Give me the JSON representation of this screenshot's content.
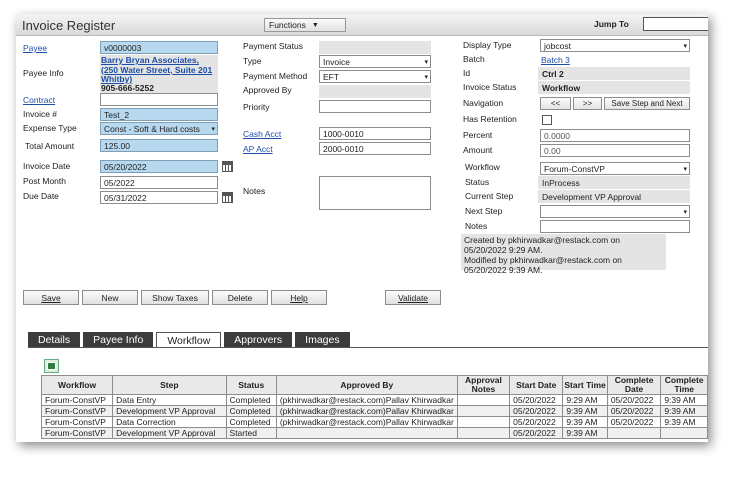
{
  "app": {
    "title": "Invoice Register",
    "functions_label": "Functions",
    "jump_to_label": "Jump To",
    "jump_to_value": ""
  },
  "left": {
    "payee_label": "Payee",
    "payee_value": "v0000003",
    "payee_info_label": "Payee Info",
    "payee_info_link": "Barry Bryan Associates, (250 Water Street, Suite 201 Whitby)",
    "payee_phone": "905-666-5252",
    "contract_label": "Contract",
    "contract_value": "",
    "invoice_no_label": "Invoice #",
    "invoice_no_value": "Test_2",
    "expense_type_label": "Expense Type",
    "expense_type_value": "Const - Soft & Hard costs",
    "total_amount_label": "Total Amount",
    "total_amount_value": "125.00",
    "invoice_date_label": "Invoice Date",
    "invoice_date_value": "05/20/2022",
    "post_month_label": "Post Month",
    "post_month_value": "05/2022",
    "due_date_label": "Due Date",
    "due_date_value": "05/31/2022"
  },
  "middle": {
    "payment_status_label": "Payment Status",
    "payment_status_value": "",
    "type_label": "Type",
    "type_value": "Invoice",
    "payment_method_label": "Payment Method",
    "payment_method_value": "EFT",
    "approved_by_label": "Approved By",
    "approved_by_value": "",
    "priority_label": "Priority",
    "priority_value": "",
    "cash_acct_label": "Cash Acct",
    "cash_acct_value": "1000-0010",
    "ap_acct_label": "AP Acct",
    "ap_acct_value": "2000-0010",
    "notes_label": "Notes",
    "notes_value": ""
  },
  "right": {
    "display_type_label": "Display Type",
    "display_type_value": "jobcost",
    "batch_label": "Batch",
    "batch_value": "Batch 3",
    "id_label": "Id",
    "id_value": "Ctrl 2",
    "invoice_status_label": "Invoice Status",
    "invoice_status_value": "Workflow",
    "navigation_label": "Navigation",
    "nav_prev": "<<",
    "nav_next": ">>",
    "nav_save_step": "Save Step and Next",
    "has_retention_label": "Has Retention",
    "percent_label": "Percent",
    "percent_value": "0.0000",
    "amount_label": "Amount",
    "amount_value": "0.00",
    "workflow_label": "Workflow",
    "workflow_value": "Forum-ConstVP",
    "status_label": "Status",
    "status_value": "InProcess",
    "current_step_label": "Current Step",
    "current_step_value": "Development VP Approval",
    "next_step_label": "Next Step",
    "next_step_value": "",
    "notes_label": "Notes",
    "notes_value": "",
    "created_line1": "Created by pkhirwadkar@restack.com on",
    "created_line2": "05/20/2022 9:29 AM.",
    "modified_line1": "Modified by pkhirwadkar@restack.com on",
    "modified_line2": "05/20/2022 9:39 AM."
  },
  "actions": {
    "save": "Save",
    "new": "New",
    "show_taxes": "Show Taxes",
    "delete": "Delete",
    "help": "Help",
    "validate": "Validate"
  },
  "tabs": [
    "Details",
    "Payee Info",
    "Workflow",
    "Approvers",
    "Images"
  ],
  "active_tab": "Workflow",
  "workflow_table": {
    "columns": [
      "Workflow",
      "Step",
      "Status",
      "Approved By",
      "Approval Notes",
      "Start Date",
      "Start Time",
      "Complete Date",
      "Complete Time"
    ],
    "rows": [
      [
        "Forum-ConstVP",
        "Data Entry",
        "Completed",
        "(pkhirwadkar@restack.com)Pallav Khirwadkar",
        "",
        "05/20/2022",
        "9:29 AM",
        "05/20/2022",
        "9:39 AM"
      ],
      [
        "Forum-ConstVP",
        "Development VP Approval",
        "Completed",
        "(pkhirwadkar@restack.com)Pallav Khirwadkar",
        "",
        "05/20/2022",
        "9:39 AM",
        "05/20/2022",
        "9:39 AM"
      ],
      [
        "Forum-ConstVP",
        "Data Correction",
        "Completed",
        "(pkhirwadkar@restack.com)Pallav Khirwadkar",
        "",
        "05/20/2022",
        "9:39 AM",
        "05/20/2022",
        "9:39 AM"
      ],
      [
        "Forum-ConstVP",
        "Development VP Approval",
        "Started",
        "",
        "",
        "05/20/2022",
        "9:39 AM",
        "",
        ""
      ]
    ]
  },
  "icons": {
    "dropdown": "chevron-down-icon",
    "calendar": "calendar-icon",
    "export": "excel-export-icon"
  }
}
